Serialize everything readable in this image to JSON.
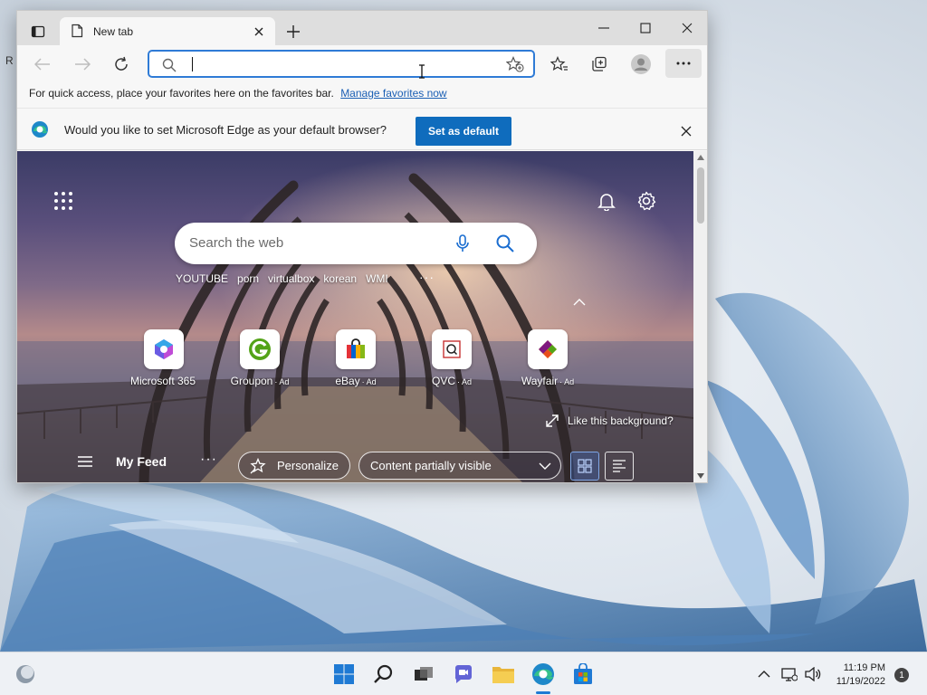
{
  "desktop": {
    "label": "R"
  },
  "browser": {
    "tab": {
      "title": "New tab"
    },
    "favorites_bar": {
      "message": "For quick access, place your favorites here on the favorites bar.",
      "link": "Manage favorites now"
    },
    "infobar": {
      "message": "Would you like to set Microsoft Edge as your default browser?",
      "button": "Set as default"
    },
    "address": {
      "value": ""
    }
  },
  "ntp": {
    "search_placeholder": "Search the web",
    "trending": [
      "YOUTUBE",
      "porn",
      "virtualbox",
      "korean",
      "WMI"
    ],
    "trending_more": "···",
    "tiles": [
      {
        "label": "Microsoft 365",
        "ad": ""
      },
      {
        "label": "Groupon",
        "ad": "· Ad"
      },
      {
        "label": "eBay",
        "ad": "· Ad"
      },
      {
        "label": "QVC",
        "ad": "· Ad"
      },
      {
        "label": "Wayfair",
        "ad": "· Ad"
      }
    ],
    "like_background": "Like this background?",
    "feed": {
      "title": "My Feed",
      "more": "···",
      "personalize": "Personalize",
      "content_visibility": "Content partially visible"
    }
  },
  "taskbar": {
    "time": "11:19 PM",
    "date": "11/19/2022",
    "notification_count": "1"
  },
  "colors": {
    "accent": "#0f6cbd",
    "address_focus": "#2f7bd6",
    "taskbar_bg": "#eef1f5"
  }
}
